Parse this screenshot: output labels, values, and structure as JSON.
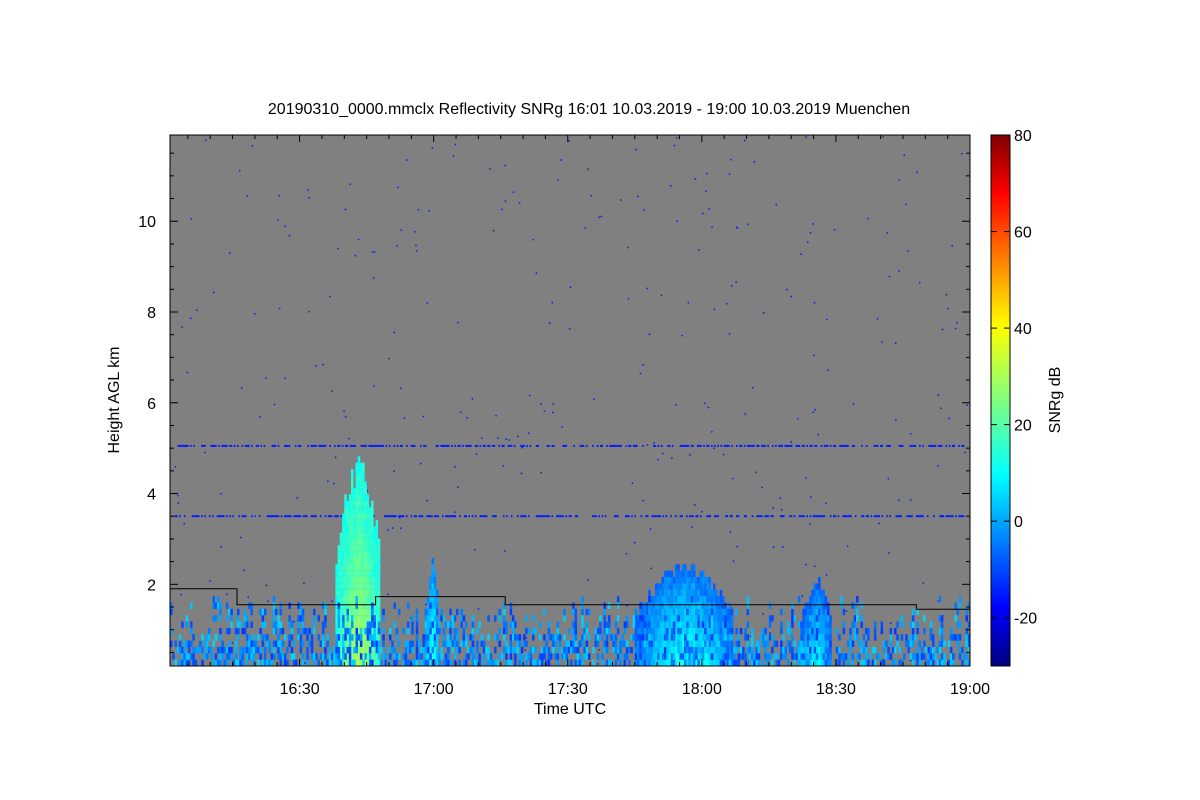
{
  "chart_data": {
    "type": "heatmap",
    "title": "20190310_0000.mmclx Reflectivity SNRg   16:01 10.03.2019 - 19:00 10.03.2019 Muenchen",
    "xlabel": "Time UTC",
    "ylabel": "Height AGL km",
    "x_ticks": [
      "16:30",
      "17:00",
      "17:30",
      "18:00",
      "18:30",
      "19:00"
    ],
    "y_ticks": [
      2,
      4,
      6,
      8,
      10
    ],
    "xlim": [
      "16:01",
      "19:00"
    ],
    "ylim": [
      0.2,
      11.9
    ],
    "background_color": "#808080",
    "grid": false,
    "colorbar": {
      "label": "SNRg dB",
      "range": [
        -30,
        80
      ],
      "ticks": [
        -20,
        0,
        20,
        40,
        60,
        80
      ],
      "colormap": "jet"
    },
    "features": [
      {
        "name": "convective cell",
        "time_start": "16:38",
        "time_end": "16:48",
        "height_top_km": 4.8,
        "max_snr_db": 30
      },
      {
        "name": "shower",
        "time_start": "16:58",
        "time_end": "17:01",
        "height_top_km": 2.5,
        "max_snr_db": 15
      },
      {
        "name": "cloud layer",
        "time_start": "17:45",
        "time_end": "18:07",
        "height_top_km": 2.4,
        "max_snr_db": 12
      },
      {
        "name": "shower",
        "time_start": "18:22",
        "time_end": "18:29",
        "height_top_km": 2.1,
        "max_snr_db": 10
      },
      {
        "name": "boundary layer echoes",
        "time_start": "16:01",
        "time_end": "19:00",
        "height_top_km": 1.7,
        "max_snr_db": 5
      }
    ],
    "noise_lines_km": [
      3.5,
      5.05
    ],
    "boundary_layer_height": [
      {
        "t": "16:01",
        "h": 1.9
      },
      {
        "t": "16:16",
        "h": 1.9
      },
      {
        "t": "16:16",
        "h": 1.55
      },
      {
        "t": "16:47",
        "h": 1.55
      },
      {
        "t": "16:47",
        "h": 1.73
      },
      {
        "t": "17:16",
        "h": 1.73
      },
      {
        "t": "17:16",
        "h": 1.55
      },
      {
        "t": "18:48",
        "h": 1.55
      },
      {
        "t": "18:48",
        "h": 1.45
      },
      {
        "t": "19:00",
        "h": 1.45
      }
    ]
  }
}
